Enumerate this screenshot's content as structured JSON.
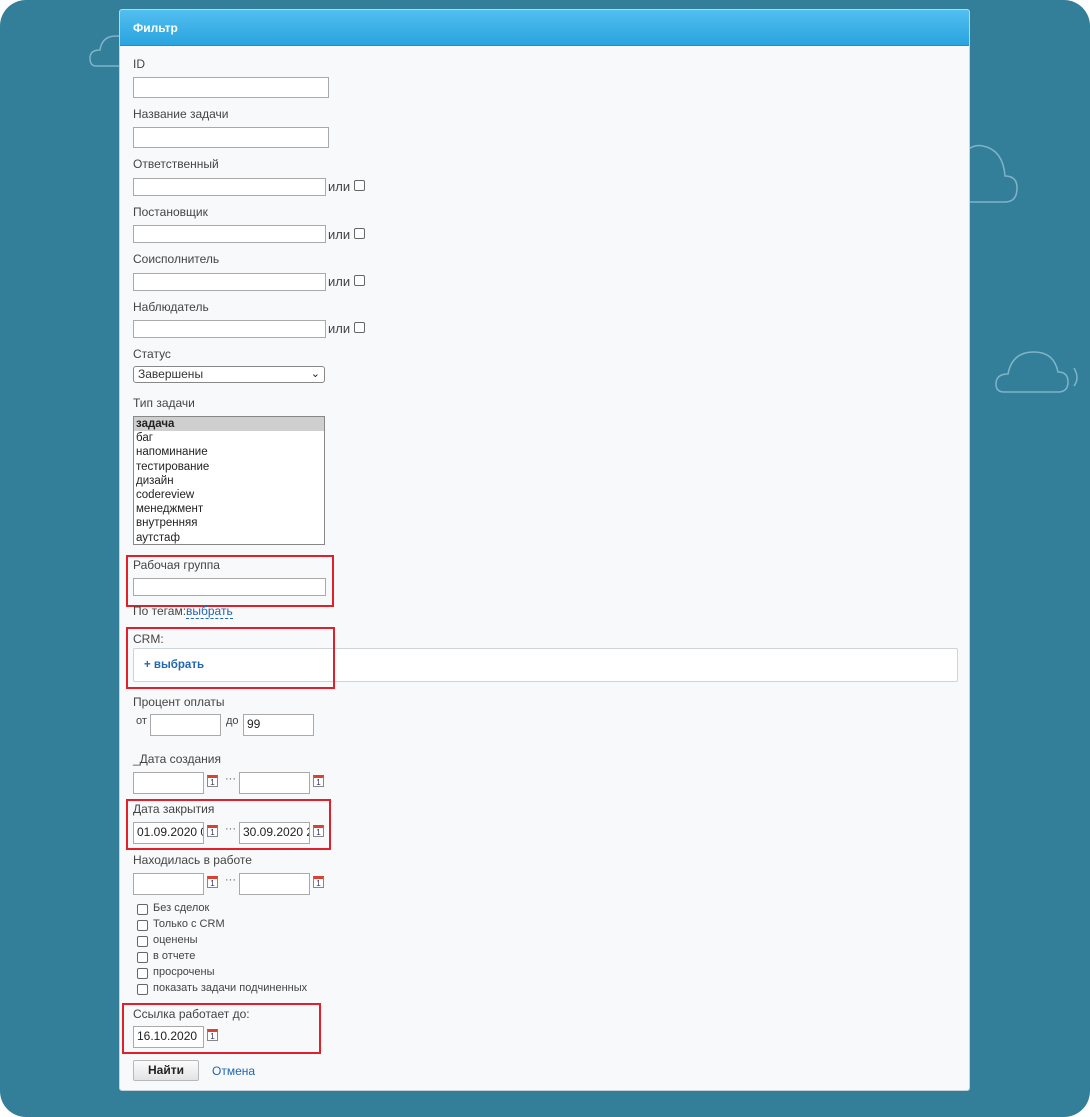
{
  "panel": {
    "title": "Фильтр"
  },
  "fields": {
    "id_label": "ID",
    "task_name_label": "Название задачи",
    "responsible_label": "Ответственный",
    "creator_label": "Постановщик",
    "coexecutor_label": "Соисполнитель",
    "observer_label": "Наблюдатель",
    "or_text": "или",
    "status_label": "Статус",
    "status_value": "Завершены",
    "task_type_label": "Тип задачи",
    "task_types": [
      "задача",
      "баг",
      "напоминание",
      "тестирование",
      "дизайн",
      "codereview",
      "менеджмент",
      "внутренняя",
      "аутстаф"
    ],
    "workgroup_label": "Рабочая группа",
    "tags_label": "По тегам:",
    "tags_link": "выбрать",
    "crm_label": "CRM:",
    "crm_add": "+ выбрать",
    "payment_label": "Процент оплаты",
    "from_text": "от",
    "to_text": "до",
    "payment_to_value": "99",
    "created_label": "_Дата создания",
    "closed_label": "Дата закрытия",
    "closed_from": "01.09.2020 0",
    "closed_to": "30.09.2020 2",
    "in_work_label": "Находилась в работе",
    "range_sep": "···",
    "cal_day": "1"
  },
  "checkboxes": [
    "Без сделок",
    "Только с CRM",
    "оценены",
    "в отчете",
    "просрочены",
    "показать задачи подчиненных"
  ],
  "link_expires": {
    "label": "Ссылка работает до:",
    "value": "16.10.2020"
  },
  "actions": {
    "find": "Найти",
    "cancel": "Отмена"
  },
  "colors": {
    "background": "#337f99",
    "header": "#2aa3df",
    "highlight": "#e0202b",
    "link": "#2067b0"
  }
}
